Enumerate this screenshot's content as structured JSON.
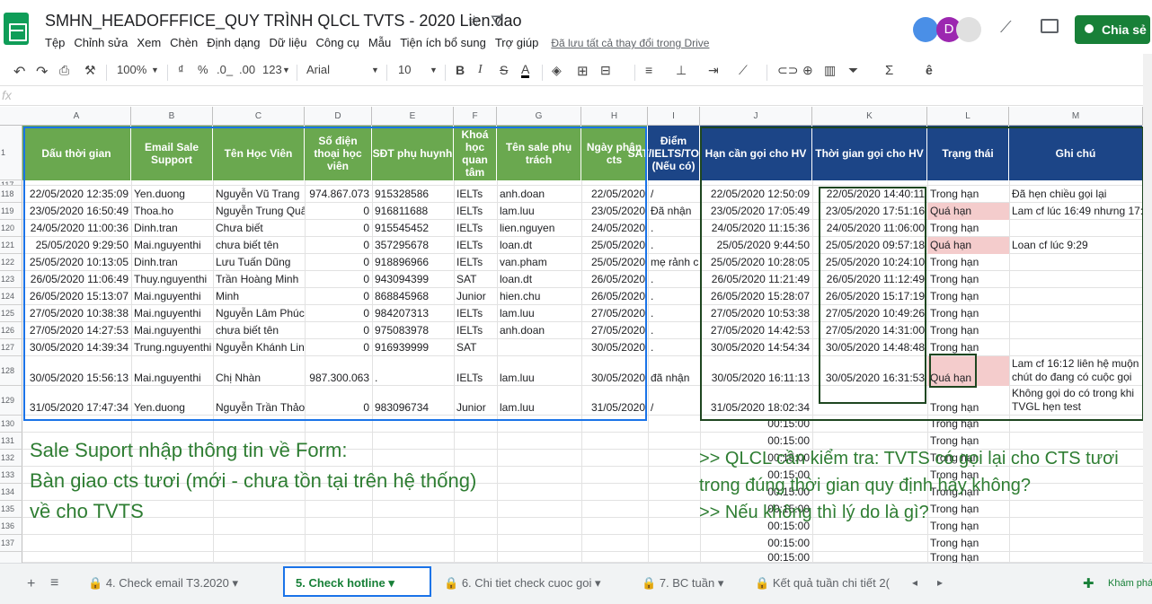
{
  "title": "SMHN_HEADOFFFICE_QUY TRÌNH QLCL TVTS - 2020 Lien.dao",
  "menu": [
    "Tệp",
    "Chỉnh sửa",
    "Xem",
    "Chèn",
    "Định dạng",
    "Dữ liệu",
    "Công cụ",
    "Mẫu",
    "Tiện ích bổ sung",
    "Trợ giúp"
  ],
  "saved_status": "Đã lưu tất cả thay đổi trong Drive",
  "share_label": "Chia sẻ",
  "avatars": [
    {
      "letter": "",
      "color": "#4a8fe7"
    },
    {
      "letter": "D",
      "color": "#9c27b0"
    },
    {
      "letter": "",
      "color": "#e0e0e0"
    }
  ],
  "toolbar": {
    "zoom": "100%",
    "currency": "₫",
    "percent": "%",
    "dec_less": ".0_",
    "dec_more": ".00",
    "format": "123",
    "font": "Arial",
    "size": "10"
  },
  "fx": "fx",
  "columns": [
    "A",
    "B",
    "C",
    "D",
    "E",
    "F",
    "G",
    "H",
    "I",
    "J",
    "K",
    "L",
    "M"
  ],
  "header_row": [
    "Dấu thời gian",
    "Email Sale Support",
    "Tên Học Viên",
    "Số điện thoại học viên",
    "SĐT phụ huynh",
    "Khoá học quan tâm",
    "Tên sale  phụ trách",
    "Ngày phân cts",
    "Điểm SAT/IELTS/TOEFL (Nếu có)",
    "Hạn cần gọi cho HV",
    "Thời gian gọi cho HV",
    "Trạng thái",
    "Ghi chú"
  ],
  "row_numbers": [
    "1",
    "117",
    "118",
    "119",
    "120",
    "121",
    "122",
    "123",
    "124",
    "125",
    "126",
    "127",
    "128",
    "129",
    "130",
    "131",
    "132",
    "133",
    "134",
    "135",
    "136",
    "137"
  ],
  "rows": [
    [
      "22/05/2020 12:35:09",
      "Yen.duong",
      "Nguyễn Vũ Trang",
      "974.867.073",
      "915328586",
      "IELTs",
      "anh.doan",
      "22/05/2020",
      "/",
      "22/05/2020 12:50:09",
      "22/05/2020 14:40:11",
      "Trong hạn",
      "Đã hẹn chiều gọi lại"
    ],
    [
      "23/05/2020 16:50:49",
      "Thoa.ho",
      "Nguyễn Trung Quân",
      "0",
      "916811688",
      "IELTs",
      "lam.luu",
      "23/05/2020",
      "Đã nhận",
      "23/05/2020 17:05:49",
      "23/05/2020 17:51:16",
      "Quá hạn",
      "Lam cf lúc 16:49 nhưng 17:5"
    ],
    [
      "24/05/2020 11:00:36",
      "Dinh.tran",
      "Chưa biết",
      "0",
      "915545452",
      "IELTs",
      "lien.nguyen",
      "24/05/2020",
      ".",
      "24/05/2020 11:15:36",
      "24/05/2020 11:06:00",
      "Trong hạn",
      ""
    ],
    [
      "25/05/2020 9:29:50",
      "Mai.nguyenthi",
      "chưa biết tên",
      "0",
      "357295678",
      "IELTs",
      "loan.dt",
      "25/05/2020",
      ".",
      "25/05/2020 9:44:50",
      "25/05/2020 09:57:18",
      "Quá hạn",
      "Loan cf lúc 9:29"
    ],
    [
      "25/05/2020 10:13:05",
      "Dinh.tran",
      "Lưu Tuấn Dũng",
      "0",
      "918896966",
      "IELTs",
      "van.pham",
      "25/05/2020",
      "mẹ rảnh c",
      "25/05/2020 10:28:05",
      "25/05/2020 10:24:10",
      "Trong hạn",
      ""
    ],
    [
      "26/05/2020 11:06:49",
      "Thuy.nguyenthi",
      "Trần Hoàng Minh",
      "0",
      "943094399",
      "SAT",
      "loan.dt",
      "26/05/2020",
      ".",
      "26/05/2020 11:21:49",
      "26/05/2020 11:12:49",
      "Trong hạn",
      ""
    ],
    [
      "26/05/2020 15:13:07",
      "Mai.nguyenthi",
      "Minh",
      "0",
      "868845968",
      "Junior",
      "hien.chu",
      "26/05/2020",
      ".",
      "26/05/2020 15:28:07",
      "26/05/2020 15:17:19",
      "Trong hạn",
      ""
    ],
    [
      "27/05/2020 10:38:38",
      "Mai.nguyenthi",
      "Nguyễn Lâm Phúc",
      "0",
      "984207313",
      "IELTs",
      "lam.luu",
      "27/05/2020",
      ".",
      "27/05/2020 10:53:38",
      "27/05/2020 10:49:26",
      "Trong hạn",
      ""
    ],
    [
      "27/05/2020 14:27:53",
      "Mai.nguyenthi",
      "chưa biết tên",
      "0",
      "975083978",
      "IELTs",
      "anh.doan",
      "27/05/2020",
      ".",
      "27/05/2020 14:42:53",
      "27/05/2020 14:31:00",
      "Trong hạn",
      ""
    ],
    [
      "30/05/2020 14:39:34",
      "Trung.nguyenthi",
      "Nguyễn Khánh Linh",
      "0",
      "916939999",
      "SAT",
      "",
      "30/05/2020",
      ".",
      "30/05/2020 14:54:34",
      "30/05/2020 14:48:48",
      "Trong hạn",
      ""
    ],
    [
      "30/05/2020 15:56:13",
      "Mai.nguyenthi",
      "Chị Nhàn",
      "987.300.063",
      ".",
      "IELTs",
      "lam.luu",
      "30/05/2020",
      "đã nhận",
      "30/05/2020 16:11:13",
      "30/05/2020 16:31:53",
      "Quá hạn",
      "Lam cf 16:12 liên hệ muộn chút do đang có cuộc gọi"
    ],
    [
      "31/05/2020 17:47:34",
      "Yen.duong",
      "Nguyễn Trần Thảo",
      "0",
      "983096734",
      "Junior",
      "lam.luu",
      "31/05/2020",
      "/",
      "31/05/2020 18:02:34",
      "",
      "Trong hạn",
      "Không gọi do có trong khi TVGL hẹn test"
    ]
  ],
  "empty_rows_J": "00:15:00",
  "empty_rows_L": "Trong hạn",
  "note_left": [
    "Sale Suport nhập thông tin về Form:",
    "Bàn giao cts tươi (mới - chưa tồn tại trên hệ thống)",
    "về cho TVTS"
  ],
  "note_right": [
    ">> QLCL cần kiểm tra: TVTS có gọi lại cho CTS tươi",
    "trong đúng thời gian quy định hay không?",
    ">> Nếu không thì lý do là gì?"
  ],
  "tabs": [
    "4. Check email T3.2020",
    "5. Check hotline",
    "6. Chi tiet check cuoc goi",
    "7. BC tuần",
    "Kết quả tuần chi tiết 2("
  ],
  "explore_label": "Khám phá",
  "colors": {
    "green_header": "#6aa84f",
    "blue_header": "#1c4587",
    "overdue_bg": "#f4cccc",
    "highlight_blue": "#1a73e8",
    "dark_green": "#1e4620"
  }
}
